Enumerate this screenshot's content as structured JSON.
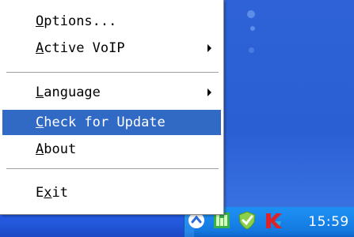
{
  "menu": {
    "items": [
      {
        "first": "O",
        "rest": "ptions...",
        "submenu": false
      },
      {
        "first": "A",
        "rest": "ctive VoIP",
        "submenu": true
      },
      {
        "first": "L",
        "rest": "anguage",
        "submenu": true
      },
      {
        "first": "C",
        "rest": "heck for Update",
        "submenu": false,
        "highlighted": true
      },
      {
        "first": "A",
        "rest": "bout",
        "submenu": false
      },
      {
        "pre": "E",
        "first": "x",
        "rest": "it",
        "submenu": false
      }
    ]
  },
  "tray": {
    "icons": [
      "arrow-icon",
      "network-icon",
      "shield-check-icon",
      "kaspersky-k-icon"
    ],
    "clock": "15:59"
  },
  "colors": {
    "highlight": "#316ac5",
    "desktop": "#2a5fd4",
    "tray": "#1c8cf0"
  }
}
